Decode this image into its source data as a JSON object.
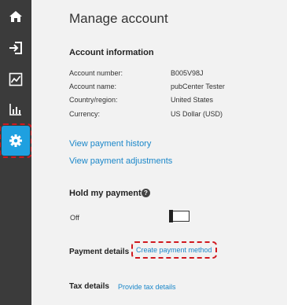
{
  "nav": {
    "items": [
      {
        "icon": "home-icon",
        "active": false
      },
      {
        "icon": "sign-in-icon",
        "active": false
      },
      {
        "icon": "line-chart-icon",
        "active": false
      },
      {
        "icon": "bar-chart-icon",
        "active": false
      },
      {
        "icon": "gear-icon",
        "active": true
      }
    ],
    "colors": {
      "rail": "#3b3b3b",
      "active": "#1ea0e0",
      "highlight": "#d0191f"
    }
  },
  "page": {
    "title": "Manage account"
  },
  "account_info": {
    "heading": "Account information",
    "rows": [
      {
        "label": "Account number:",
        "value": "B005V98J"
      },
      {
        "label": "Account name:",
        "value": "pubCenter Tester"
      },
      {
        "label": "Country/region:",
        "value": "United States"
      },
      {
        "label": "Currency:",
        "value": "US Dollar (USD)"
      }
    ]
  },
  "links": {
    "payment_history": "View payment history",
    "payment_adjustments": "View payment adjustments"
  },
  "hold": {
    "heading": "Hold my payment",
    "help_icon": "?",
    "toggle_label": "Off",
    "toggle_on": false
  },
  "payment": {
    "label": "Payment details",
    "link": "Create payment method"
  },
  "tax": {
    "label": "Tax details",
    "link": "Provide tax details"
  },
  "colors": {
    "link": "#1b87c9",
    "background": "#f2f2f2"
  }
}
